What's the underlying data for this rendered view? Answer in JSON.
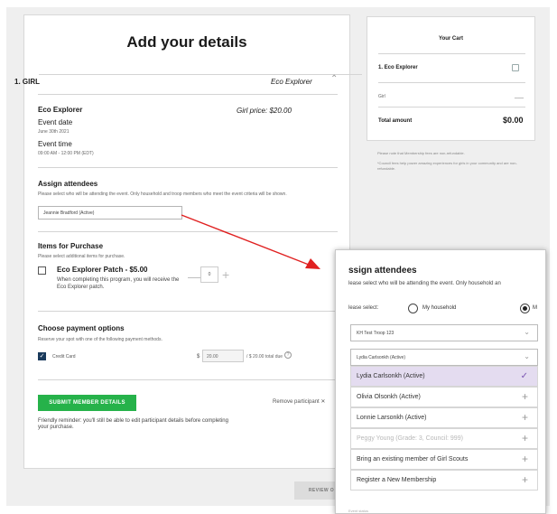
{
  "form": {
    "title": "Add your details",
    "section_label": "1. GIRL",
    "section_program": "Eco Explorer",
    "program_name": "Eco Explorer",
    "program_price": "Girl price: $20.00",
    "event_date_label": "Event date",
    "event_date_value": "June 30th 2021",
    "event_time_label": "Event time",
    "event_time_value": "09:00 AM - 12:00 PM (EDT)",
    "assign_title": "Assign attendees",
    "assign_desc": "Please select who will be attending the event. Only household and troop members who meet the event criteria will be shown.",
    "attendee_value": "Jeannie Bradford (Active)",
    "items_title": "Items for Purchase",
    "items_desc": "Please select additional items for purchase.",
    "patch_title": "Eco Explorer Patch - $5.00",
    "patch_desc": "When completing this program, you will receive the Eco Explorer patch.",
    "patch_qty": "0",
    "payment_title": "Choose payment options",
    "payment_desc": "Reserve your spot with one of the following payment methods.",
    "payment_method": "Credit Card",
    "currency": "$",
    "payment_amount": "20.00",
    "total_due": "/ $ 20.00 total due",
    "submit_label": "SUBMIT MEMBER DETAILS",
    "remove_label": "Remove participant",
    "reminder": "Friendly reminder: you'll still be able to edit participant details before completing your purchase.",
    "review_label": "REVIEW O"
  },
  "cart": {
    "title": "Your Cart",
    "item": "1. Eco Explorer",
    "girl_label": "Girl",
    "girl_value": "___",
    "total_label": "Total amount",
    "total_value": "$0.00",
    "note1": "Please note that Membership fees are non-refundable.",
    "note2": "*Council fees help power amazing experiences for girls in your community and are non-refundable."
  },
  "overlay": {
    "title": "ssign attendees",
    "desc": "lease select who will be attending the event. Only household an",
    "please_select": "lease select:",
    "radio_household": "My household",
    "radio_other": "M",
    "troop_select": "KH Test Troop 123",
    "attendee_select": "Lydia Carlsonkh (Active)",
    "options": [
      {
        "label": "Lydia Carlsonkh (Active)",
        "mark": "✓"
      },
      {
        "label": "Olivia Olsonkh (Active)",
        "mark": "+"
      },
      {
        "label": "Lonnie Larsonkh (Active)",
        "mark": "+"
      },
      {
        "label": "Peggy Young (Grade: 3, Council: 999)",
        "mark": "+"
      },
      {
        "label": "Bring an existing member of Girl Scouts",
        "mark": "+"
      },
      {
        "label": "Register a New Membership",
        "mark": "+"
      }
    ],
    "footer": "Event status"
  },
  "colors": {
    "submit_green": "#26b24a",
    "arrow_red": "#e02020",
    "selected_option": "#e4dcf0",
    "check_purple": "#7b55b3"
  }
}
